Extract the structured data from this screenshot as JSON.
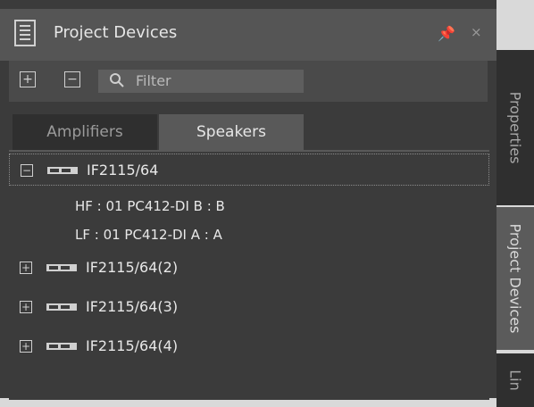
{
  "window": {
    "title": "Project Devices",
    "pin_glyph": "📌",
    "close_glyph": "×",
    "icons": {
      "window": "document-list-icon",
      "pin": "pin-icon",
      "close": "close-icon"
    }
  },
  "toolbar": {
    "expand_all_label": "+",
    "collapse_all_label": "−",
    "filter_placeholder": "Filter"
  },
  "tabs": {
    "items": [
      {
        "label": "Amplifiers",
        "selected": false
      },
      {
        "label": "Speakers",
        "selected": true
      }
    ]
  },
  "tree": {
    "items": [
      {
        "label": "IF2115/64",
        "expanded": true,
        "children": [
          "HF : 01 PC412-DI B : B",
          "LF : 01 PC412-DI A : A"
        ]
      },
      {
        "label": "IF2115/64(2)",
        "expanded": false
      },
      {
        "label": "IF2115/64(3)",
        "expanded": false
      },
      {
        "label": "IF2115/64(4)",
        "expanded": false
      }
    ],
    "toggle_open": "−",
    "toggle_closed": "+"
  },
  "side_tabs": {
    "items": [
      {
        "label": "Properties",
        "selected": false
      },
      {
        "label": "Project Devices",
        "selected": true
      },
      {
        "label": "Lin",
        "selected": false
      }
    ]
  },
  "colors": {
    "panel_bg": "#3b3b3b",
    "title_bg": "#555555",
    "selected_tab_bg": "#595959",
    "text": "#e8e8e8"
  }
}
